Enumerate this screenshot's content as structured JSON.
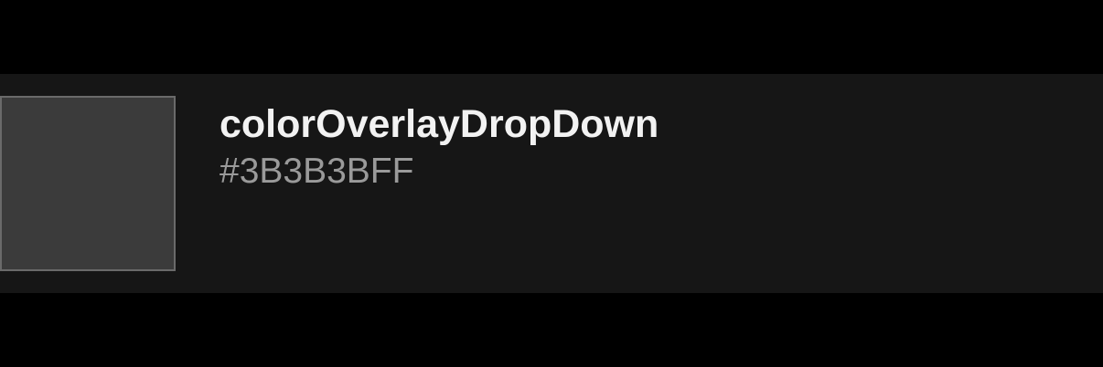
{
  "color_entry": {
    "name": "colorOverlayDropDown",
    "hex": "#3B3B3BFF",
    "swatch_color": "#3B3B3B",
    "row_background": "#161616"
  }
}
